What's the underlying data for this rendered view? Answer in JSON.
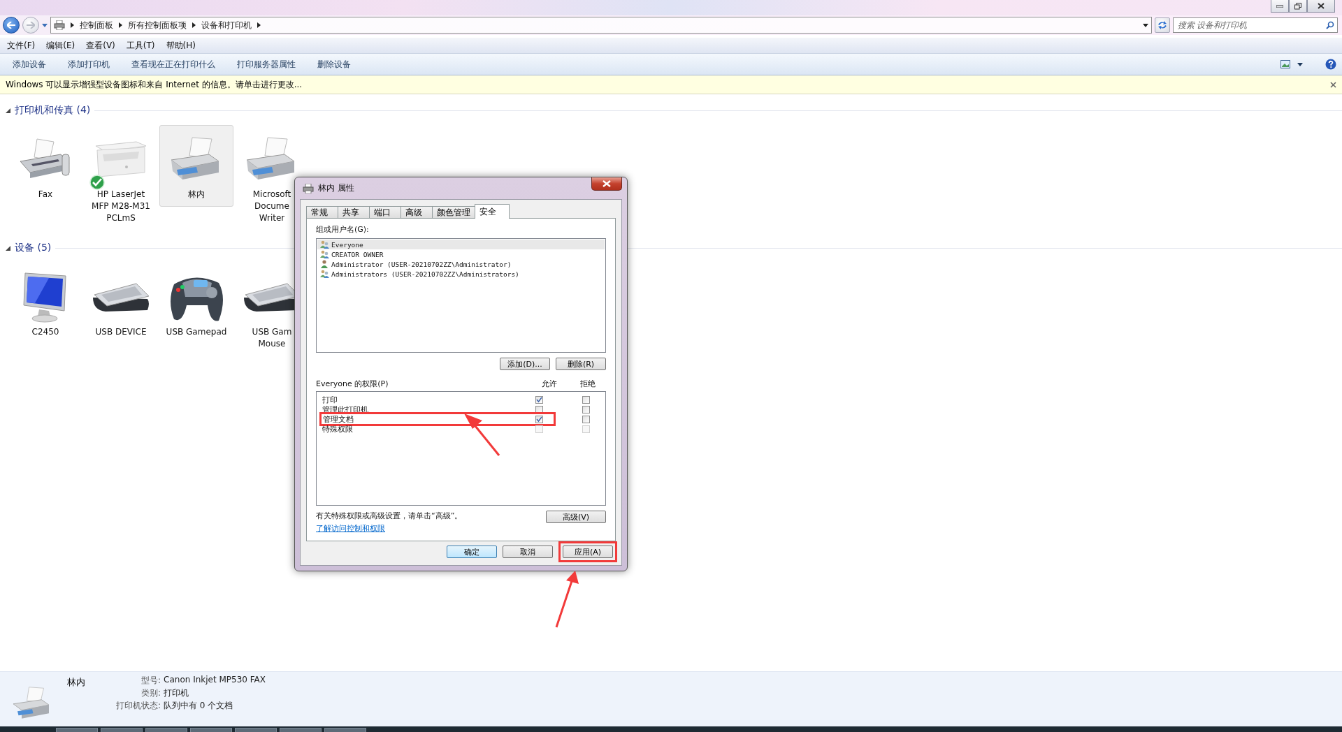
{
  "address_bar": {
    "path": [
      "控制面板",
      "所有控制面板项",
      "设备和打印机"
    ]
  },
  "search": {
    "placeholder": "搜索 设备和打印机"
  },
  "menu": [
    "文件(F)",
    "编辑(E)",
    "查看(V)",
    "工具(T)",
    "帮助(H)"
  ],
  "toolbar": [
    "添加设备",
    "添加打印机",
    "查看现在正在打印什么",
    "打印服务器属性",
    "删除设备"
  ],
  "info_bar": "Windows 可以显示增强型设备图标和来自 Internet 的信息。请单击进行更改...",
  "groups": [
    {
      "title": "打印机和传真 (4)",
      "expanded": true,
      "items": [
        {
          "lines": [
            "Fax"
          ],
          "kind": "fax",
          "selected": false,
          "default": false
        },
        {
          "lines": [
            "HP LaserJet",
            "MFP M28-M31",
            "PCLmS"
          ],
          "kind": "laser",
          "selected": false,
          "default": true
        },
        {
          "lines": [
            "林内"
          ],
          "kind": "inkjet",
          "selected": true,
          "default": false
        },
        {
          "lines": [
            "Microsoft",
            "Docume",
            "Writer"
          ],
          "kind": "inkjet",
          "selected": false,
          "default": false
        }
      ]
    },
    {
      "title": "设备 (5)",
      "expanded": true,
      "items": [
        {
          "lines": [
            "C2450"
          ],
          "kind": "monitor",
          "selected": false,
          "default": false
        },
        {
          "lines": [
            "USB DEVICE"
          ],
          "kind": "keyboard",
          "selected": false,
          "default": false
        },
        {
          "lines": [
            "USB Gamepad"
          ],
          "kind": "gamepad",
          "selected": false,
          "default": false
        },
        {
          "lines": [
            "USB Gam",
            "Mouse"
          ],
          "kind": "keyboard",
          "selected": false,
          "default": false
        }
      ]
    }
  ],
  "dialog": {
    "title": "林内 属性",
    "tabs": [
      {
        "label": "常规",
        "selected": false
      },
      {
        "label": "共享",
        "selected": false
      },
      {
        "label": "端口",
        "selected": false
      },
      {
        "label": "高级",
        "selected": false
      },
      {
        "label": "颜色管理",
        "selected": false
      },
      {
        "label": "安全",
        "selected": true
      }
    ],
    "users_label": "组或用户名(G):",
    "users": [
      {
        "name": "Everyone",
        "kind": "group",
        "selected": true
      },
      {
        "name": "CREATOR OWNER",
        "kind": "group",
        "selected": false
      },
      {
        "name": "Administrator (USER-20210702ZZ\\Administrator)",
        "kind": "user",
        "selected": false
      },
      {
        "name": "Administrators (USER-20210702ZZ\\Administrators)",
        "kind": "group",
        "selected": false
      }
    ],
    "user_buttons": [
      "添加(D)...",
      "删除(R)"
    ],
    "permissions_label": "Everyone 的权限(P)",
    "columns": [
      "允许",
      "拒绝"
    ],
    "permissions": [
      {
        "name": "打印",
        "allow": true,
        "deny": false,
        "disabled": false,
        "highlighted": false
      },
      {
        "name": "管理此打印机",
        "allow": false,
        "deny": false,
        "disabled": false,
        "highlighted": false
      },
      {
        "name": "管理文档",
        "allow": true,
        "deny": false,
        "disabled": false,
        "highlighted": true
      },
      {
        "name": "特殊权限",
        "allow": false,
        "deny": false,
        "disabled": true,
        "highlighted": false
      }
    ],
    "note": "有关特殊权限或高级设置，请单击“高级”。",
    "advanced_button": "高级(V)",
    "link": "了解访问控制和权限",
    "buttons": [
      {
        "label": "确定",
        "default": true,
        "highlighted": false
      },
      {
        "label": "取消",
        "default": false,
        "highlighted": false
      },
      {
        "label": "应用(A)",
        "default": false,
        "highlighted": true
      }
    ]
  },
  "details": {
    "name": "林内",
    "fields": [
      {
        "label": "型号:",
        "value": "Canon Inkjet MP530 FAX"
      },
      {
        "label": "类别:",
        "value": "打印机"
      },
      {
        "label": "打印机状态:",
        "value": "队列中有 0 个文档"
      }
    ]
  }
}
